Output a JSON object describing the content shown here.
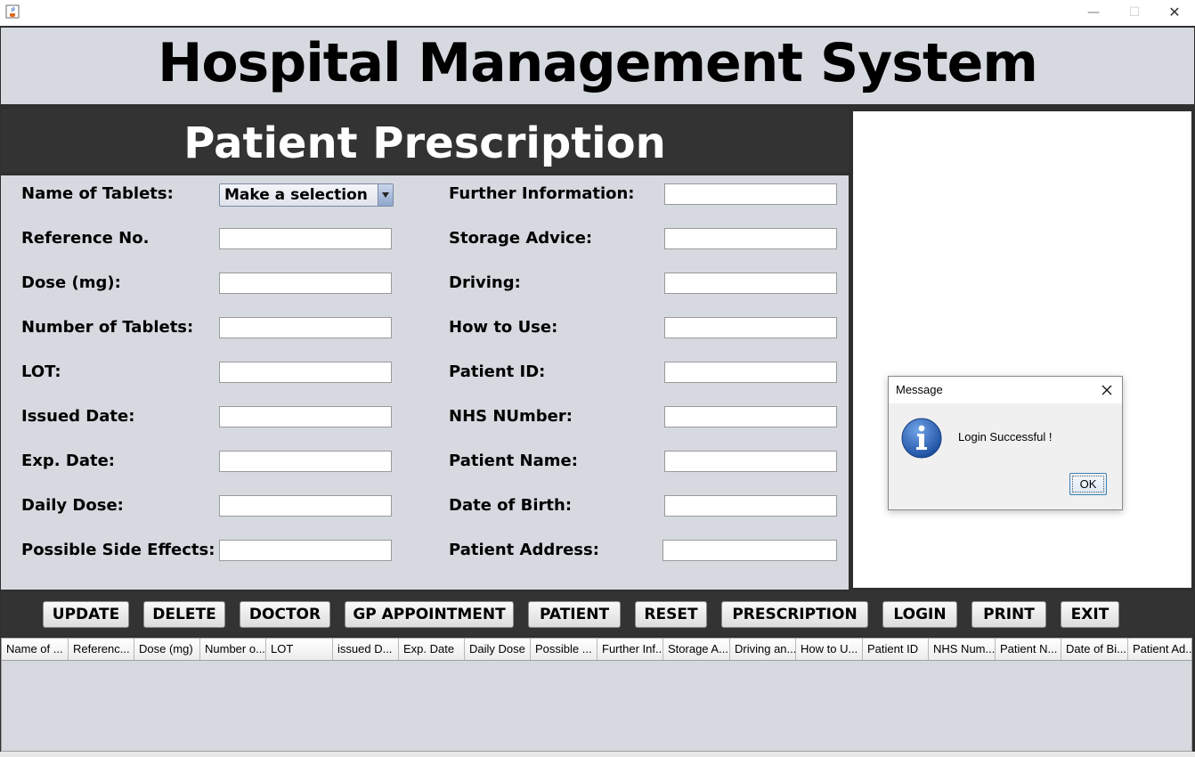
{
  "window": {
    "app_icon": "java-cup-icon",
    "minimize_glyph": "—",
    "maximize_glyph": "☐",
    "close_glyph": "✕"
  },
  "header": {
    "title": "Hospital Management System"
  },
  "panel": {
    "title": "Patient Prescription"
  },
  "form": {
    "tablet_combo": {
      "label": "Name of Tablets:",
      "selected": "Make a selection"
    },
    "left_labels": [
      "Reference No.",
      "Dose (mg):",
      "Number of Tablets:",
      "LOT:",
      "Issued Date:",
      "Exp. Date:",
      "Daily Dose:",
      "Possible Side Effects:"
    ],
    "right_labels": [
      "Further Information:",
      "Storage Advice:",
      "Driving:",
      "How to Use:",
      "Patient ID:",
      "NHS NUmber:",
      "Patient Name:",
      "Date of Birth:",
      "Patient Address:"
    ],
    "left_values": [
      "",
      "",
      "",
      "",
      "",
      "",
      "",
      ""
    ],
    "right_values": [
      "",
      "",
      "",
      "",
      "",
      "",
      "",
      "",
      ""
    ]
  },
  "buttons": [
    "UPDATE",
    "DELETE",
    "DOCTOR",
    "GP APPOINTMENT",
    "PATIENT",
    "RESET",
    "PRESCRIPTION",
    "LOGIN",
    "PRINT",
    "EXIT"
  ],
  "table": {
    "columns": [
      "Name of ...",
      "Referenc...",
      "Dose (mg)",
      "Number o...",
      "LOT",
      "issued D...",
      "Exp. Date",
      "Daily Dose",
      "Possible ...",
      "Further Inf...",
      "Storage A...",
      "Driving an...",
      "How to U...",
      "Patient ID",
      "NHS Num...",
      "Patient N...",
      "Date of Bi...",
      "Patient Ad..."
    ],
    "rows": []
  },
  "dialog": {
    "title": "Message",
    "message": "Login Successful !",
    "ok_label": "OK",
    "icon": "info-icon"
  },
  "colors": {
    "header_bg": "#d6d9df",
    "dark_bar": "#333333",
    "info_blue": "#2a62b4"
  }
}
